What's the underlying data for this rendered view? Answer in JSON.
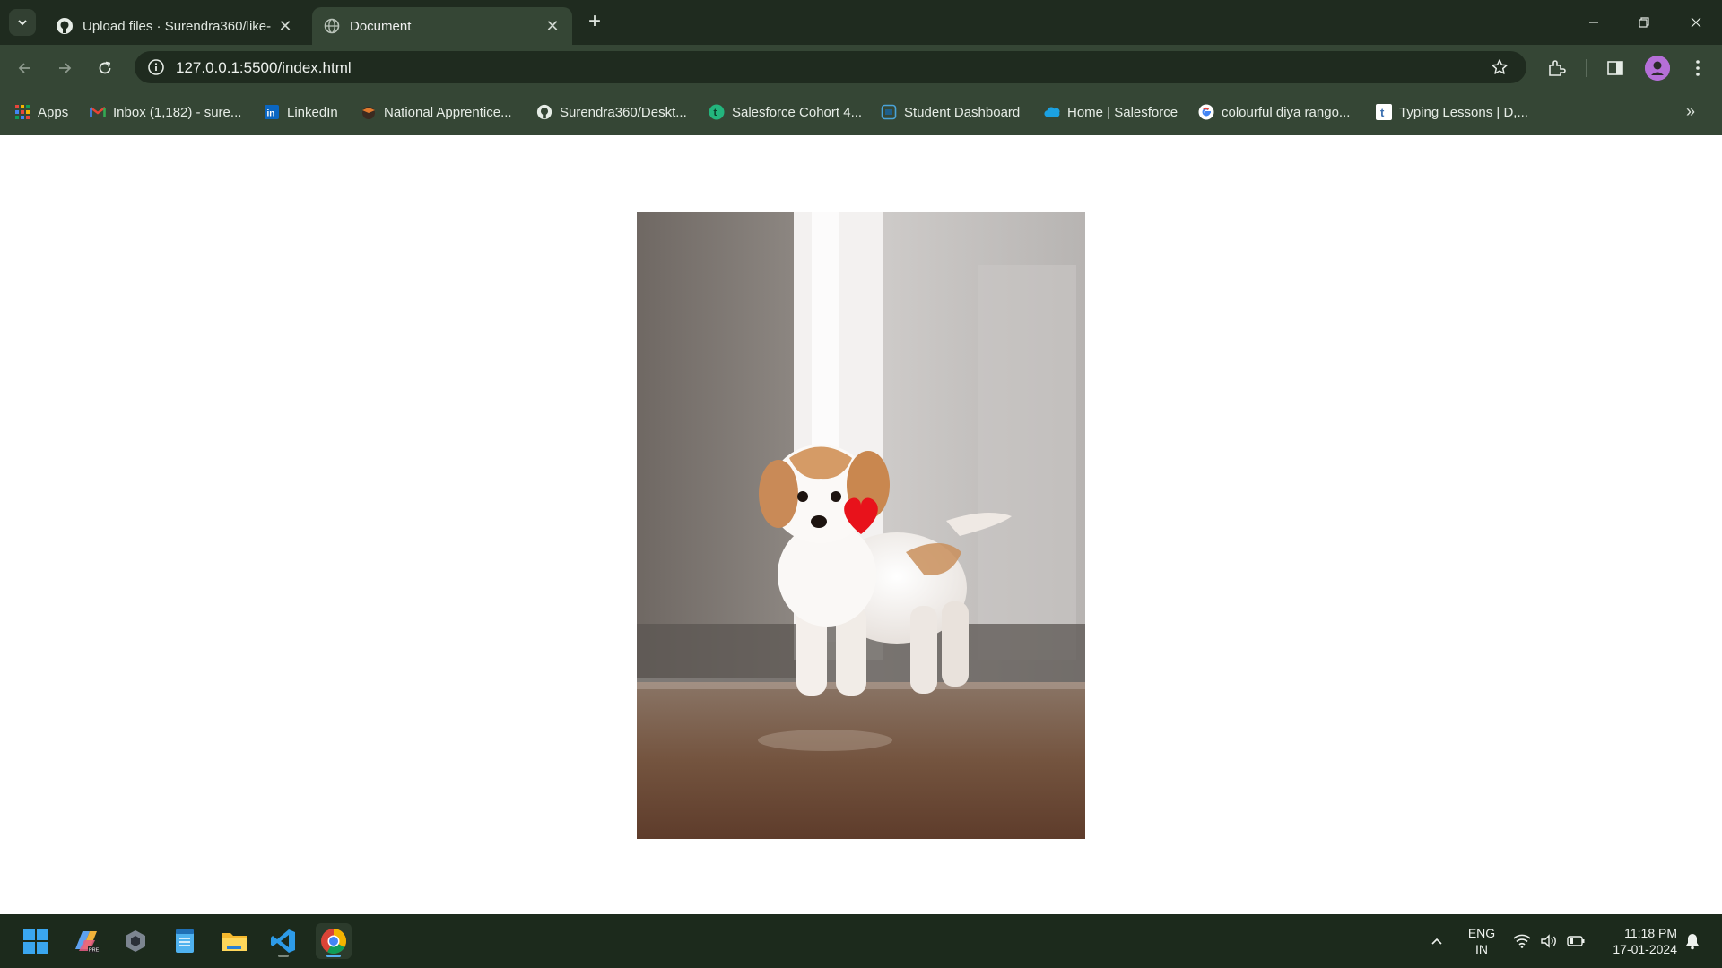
{
  "browser": {
    "tabs": [
      {
        "title": "Upload files · Surendra360/like-",
        "icon": "github-icon"
      },
      {
        "title": "Document",
        "icon": "globe-icon",
        "active": true
      }
    ],
    "url": "127.0.0.1:5500/index.html",
    "bookmarks": [
      {
        "label": "Apps",
        "icon": "apps-grid-icon"
      },
      {
        "label": "Inbox (1,182) - sure...",
        "icon": "gmail-icon"
      },
      {
        "label": "LinkedIn",
        "icon": "linkedin-icon"
      },
      {
        "label": "National Apprentice...",
        "icon": "graduation-cap-icon"
      },
      {
        "label": "Surendra360/Deskt...",
        "icon": "github-icon"
      },
      {
        "label": "Salesforce Cohort 4...",
        "icon": "trailhead-icon"
      },
      {
        "label": "Student Dashboard",
        "icon": "dashboard-icon"
      },
      {
        "label": "Home | Salesforce",
        "icon": "salesforce-cloud-icon"
      },
      {
        "label": "colourful diya rango...",
        "icon": "google-icon"
      },
      {
        "label": "Typing Lessons | D,...",
        "icon": "typing-icon"
      }
    ]
  },
  "page": {
    "image_subject": "puppy with red heart"
  },
  "taskbar": {
    "apps": [
      "start-icon",
      "copilot-icon",
      "app-icon",
      "notepad-icon",
      "file-explorer-icon",
      "vscode-icon",
      "chrome-icon"
    ],
    "language": {
      "line1": "ENG",
      "line2": "IN"
    },
    "time": "11:18 PM",
    "date": "17-01-2024"
  },
  "colors": {
    "chrome_dark": "#1f2b1f",
    "chrome_toolbar": "#354635",
    "heart": "#e8121b",
    "accent": "#55b1f2"
  }
}
